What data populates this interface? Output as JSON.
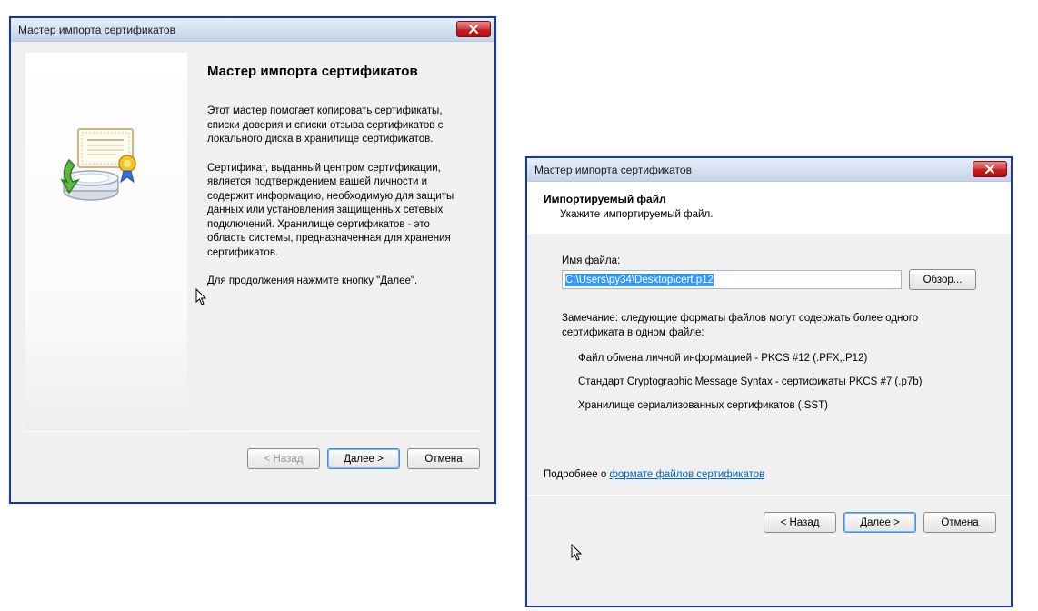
{
  "window1": {
    "title": "Мастер импорта сертификатов",
    "heading": "Мастер импорта сертификатов",
    "para1": "Этот мастер помогает копировать сертификаты, списки доверия и списки отзыва сертификатов с локального диска в хранилище сертификатов.",
    "para2": "Сертификат, выданный центром сертификации, является подтверждением вашей личности и содержит информацию, необходимую для защиты данных или установления защищенных сетевых подключений. Хранилище сертификатов - это область системы, предназначенная для хранения сертификатов.",
    "para3": "Для продолжения нажмите кнопку \"Далее\".",
    "buttons": {
      "back": "< Назад",
      "next": "Далее >",
      "cancel": "Отмена"
    }
  },
  "window2": {
    "title": "Мастер импорта сертификатов",
    "header_title": "Импортируемый файл",
    "header_sub": "Укажите импортируемый файл.",
    "filename_label": "Имя файла:",
    "filename_value": "C:\\Users\\py34\\Desktop\\cert.p12",
    "browse": "Обзор...",
    "note": "Замечание: следующие форматы файлов могут содержать более одного сертификата в одном файле:",
    "fmt1": "Файл обмена личной информацией - PKCS #12 (.PFX,.P12)",
    "fmt2": "Стандарт Cryptographic Message Syntax - сертификаты PKCS #7 (.p7b)",
    "fmt3": "Хранилище сериализованных сертификатов (.SST)",
    "more_prefix": "Подробнее о ",
    "more_link": "формате файлов сертификатов",
    "buttons": {
      "back": "< Назад",
      "next": "Далее >",
      "cancel": "Отмена"
    }
  }
}
